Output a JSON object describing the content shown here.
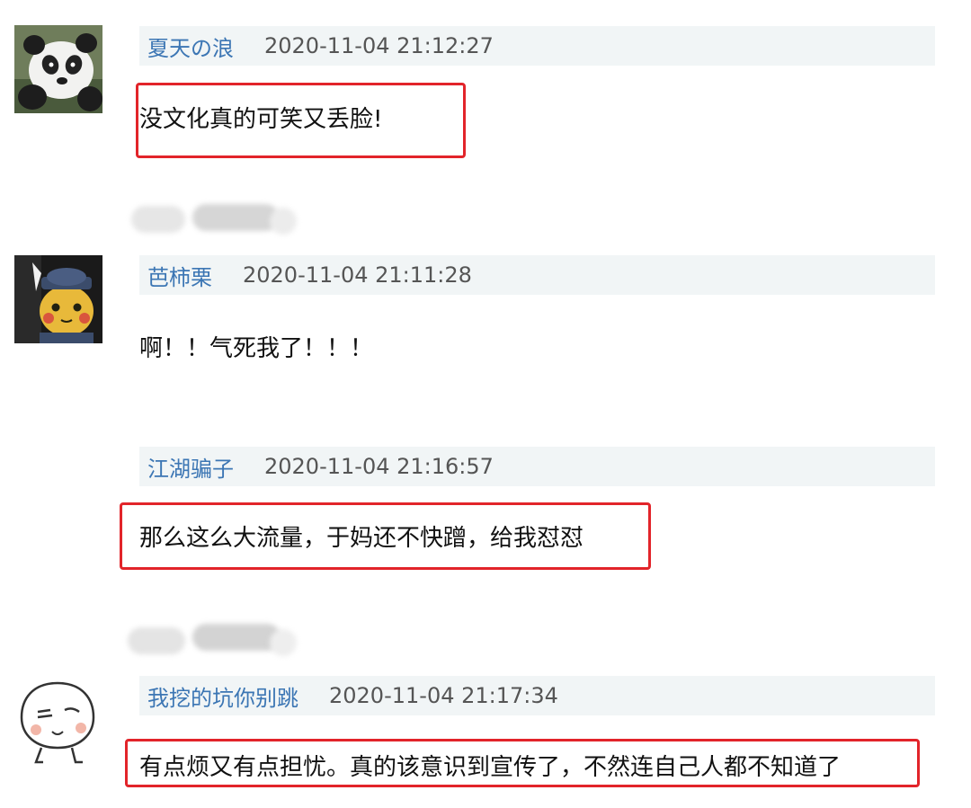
{
  "comments": [
    {
      "username": "夏天の浪",
      "timestamp": "2020-11-04 21:12:27",
      "text": "没文化真的可笑又丢脸!",
      "avatar": "panda-avatar-icon"
    },
    {
      "username": "芭柿栗",
      "timestamp": "2020-11-04 21:11:28",
      "text": "啊！！气死我了！！！",
      "avatar": "pikachu-detective-avatar-icon"
    },
    {
      "username": "江湖骗子",
      "timestamp": "2020-11-04 21:16:57",
      "text": "那么这么大流量，于妈还不快蹭，给我怼怼",
      "avatar": ""
    },
    {
      "username": "我挖的坑你别跳",
      "timestamp": "2020-11-04 21:17:34",
      "text": "有点烦又有点担忧。真的该意识到宣传了，不然连自己人都不知道了",
      "avatar": "cartoon-face-avatar-icon"
    }
  ],
  "colors": {
    "highlight": "#e2242a",
    "username": "#3c76b4",
    "header_bg": "#f1f5f6"
  }
}
